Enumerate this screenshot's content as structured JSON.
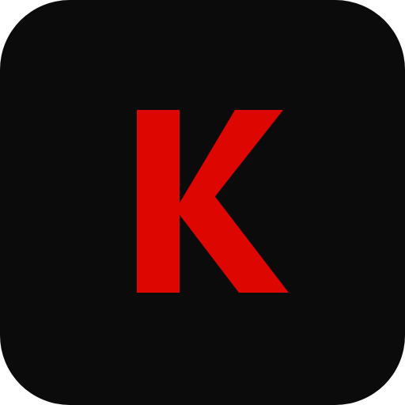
{
  "icon": {
    "name": "app-icon",
    "letter": "K",
    "colors": {
      "background": "#0b0b0c",
      "letter": "#dd0600"
    }
  }
}
